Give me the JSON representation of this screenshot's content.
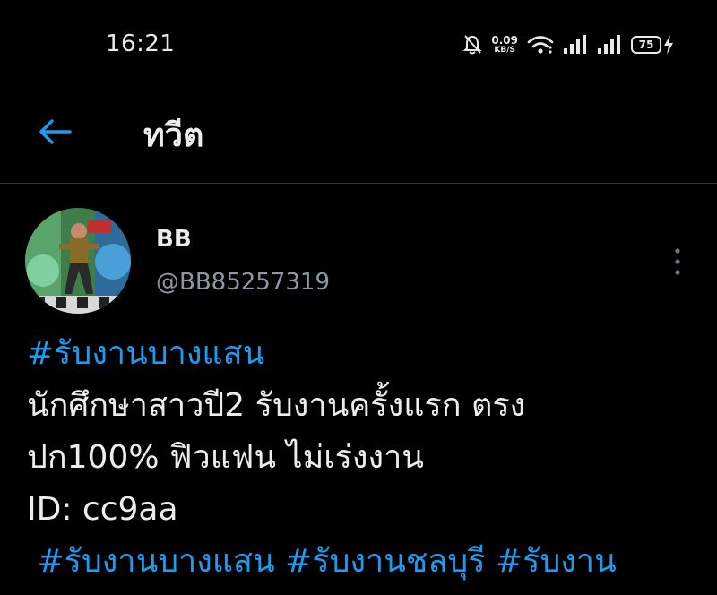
{
  "status_bar": {
    "time": "16:21",
    "network_speed_value": "0.09",
    "network_speed_unit": "KB/S",
    "battery_level": "75"
  },
  "header": {
    "title": "ทวีต"
  },
  "tweet": {
    "author": {
      "name": "BB",
      "handle": "@BB85257319"
    },
    "lines": {
      "hashtag_1": "#รับงานบางแสน",
      "text_1": "นักศึกษาสาวปี2 รับงานครั้งแรก ตรง",
      "text_2": "ปก100% ฟิวแฟน ไม่เร่งงาน",
      "text_3": "ID: cc9aa",
      "hashtag_2": "#รับงานบางแสน",
      "hashtag_3": "#รับงานชลบุรี",
      "hashtag_4": "#รับงาน"
    }
  },
  "colors": {
    "background": "#000000",
    "link": "#1d9bf0",
    "secondary_text": "#8b98a5",
    "divider": "#2f3336"
  },
  "icons": [
    "bell-off-icon",
    "wifi-icon",
    "signal-icon",
    "battery-icon",
    "charging-bolt-icon",
    "back-arrow-icon",
    "more-vertical-icon"
  ]
}
